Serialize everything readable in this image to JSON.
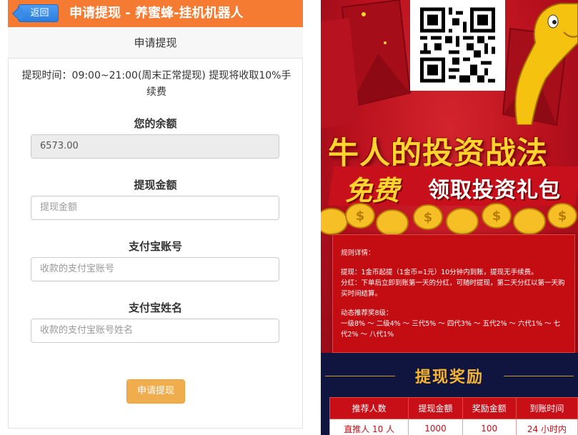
{
  "header": {
    "back_label": "返回",
    "title": "申请提现 - 养蜜蜂-挂机机器人"
  },
  "subheader": {
    "title": "申请提现"
  },
  "notice": "提现时间：09:00~21:00(周末正常提现) 提现将收取10%手续费",
  "form": {
    "balance_label": "您的余额",
    "balance_value": "6573.00",
    "amount_label": "提现金额",
    "amount_placeholder": "提现金额",
    "alipay_account_label": "支付宝账号",
    "alipay_account_placeholder": "收款的支付宝账号",
    "alipay_name_label": "支付宝姓名",
    "alipay_name_placeholder": "收款的支付宝账号姓名",
    "submit_label": "申请提现"
  },
  "poster": {
    "headline": "牛人的投资战法",
    "free_word": "免费",
    "gift_text": "领取投资礼包",
    "rules": {
      "heading": "规则详情：",
      "line1": "提现：1金币起提（1金币=1元）10分钟内到账，提现无手续费。",
      "line2": "分红：下单后立即到账第一天的分红，可随时提现，第二天分红以第一天购买时间结算。",
      "line3": "动态推荐奖8级：",
      "line4": "一级8% ～ 二级4% ～ 三代5% ～ 四代3% ～ 五代2% ～ 六代1% ～ 七代2% ～ 八代1%"
    },
    "reward_title": "提现奖励",
    "table": {
      "headers": [
        "推荐人数",
        "提现金额",
        "奖励金额",
        "到账时间"
      ],
      "rows": [
        [
          "直推人 10 人",
          "1000",
          "100",
          "24 小时内"
        ]
      ]
    }
  },
  "colors": {
    "header_orange": "#f57b33",
    "back_blue": "#2b7fe0",
    "submit_orange": "#f0ad4e",
    "poster_red": "#c8102a",
    "poster_gold": "#ffd52e",
    "navy": "#10153f"
  }
}
